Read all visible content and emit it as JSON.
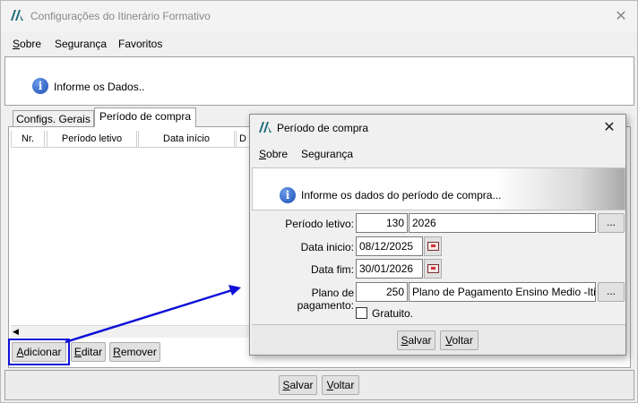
{
  "window": {
    "title": "Configurações do Itinerário Formativo",
    "close_symbol": "✕"
  },
  "menu": {
    "sobre": "Sobre",
    "seguranca": "Segurança",
    "favoritos": "Favoritos"
  },
  "banner": {
    "text": "Informe os Dados.."
  },
  "tabs": {
    "configs": "Configs. Gerais",
    "periodo": "Período de compra"
  },
  "grid": {
    "columns": [
      "Nr.",
      "Período letivo",
      "Data início",
      "D"
    ]
  },
  "buttons": {
    "adicionar": "Adicionar",
    "editar": "Editar",
    "remover": "Remover",
    "salvar": "Salvar",
    "voltar": "Voltar"
  },
  "dialog": {
    "title": "Período de compra",
    "close_symbol": "✕",
    "menu": {
      "sobre": "Sobre",
      "seguranca": "Segurança"
    },
    "banner_text": "Informe os dados do período de compra...",
    "fields": {
      "periodo_letivo_label": "Período letivo:",
      "periodo_letivo_code": "130",
      "periodo_letivo_desc": "2026",
      "data_inicio_label": "Data inicio:",
      "data_inicio_value": "08/12/2025",
      "data_fim_label": "Data fim:",
      "data_fim_value": "30/01/2026",
      "plano_label": "Plano de pagamento:",
      "plano_code": "250",
      "plano_desc": "Plano de Pagamento Ensino Medio -Iti",
      "gratuito_label": "Gratuito."
    },
    "dots_label": "...",
    "buttons": {
      "salvar": "Salvar",
      "voltar": "Voltar"
    }
  },
  "colors": {
    "highlight": "#1010d8",
    "arrow": "#1010d8"
  }
}
